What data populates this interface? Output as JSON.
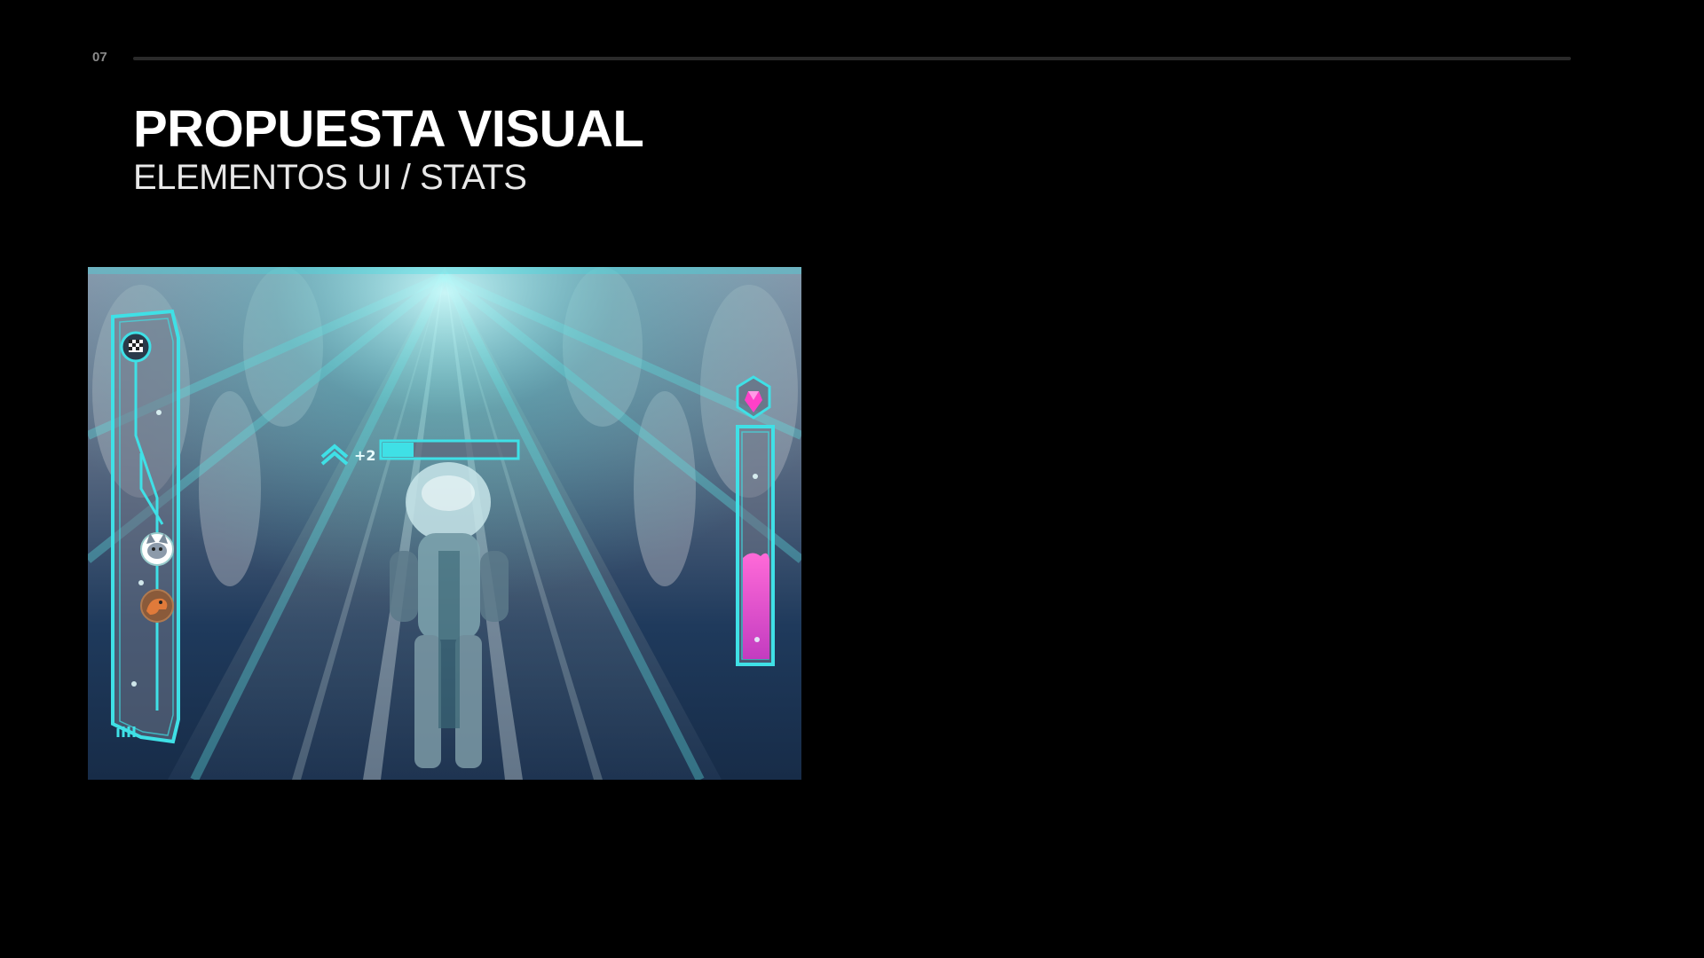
{
  "slide": {
    "page_number": "07",
    "title": "PROPUESTA VISUAL",
    "subtitle": "ELEMENTOS UI / STATS"
  },
  "game_hud": {
    "xp_bonus": "+2",
    "xp_bar_fill": 0.23,
    "accent_color": "#3fe0e6",
    "energy_color": "#e040c8",
    "energy_level": 0.5,
    "progress_track_icons": [
      "checkered-flag-icon",
      "cat-avatar-icon",
      "dinosaur-avatar-icon"
    ],
    "power_icon": "magenta-gem-icon"
  }
}
